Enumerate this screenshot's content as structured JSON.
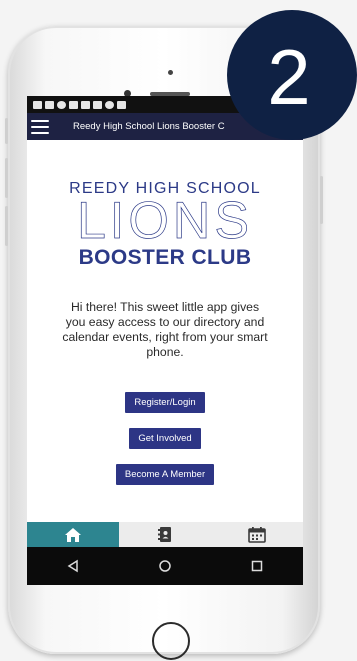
{
  "header": {
    "title": "Reedy High School Lions Booster C"
  },
  "brand": {
    "line1": "REEDY HIGH SCHOOL",
    "line2": "LIONS",
    "line3": "BOOSTER CLUB"
  },
  "intro_text": "Hi there! This sweet little app gives you easy access to our directory and calendar events, right from your smart phone.",
  "buttons": {
    "register": "Register/Login",
    "get_involved": "Get Involved",
    "become_member": "Become A Member"
  },
  "tabs": [
    {
      "icon": "home-icon",
      "active": true
    },
    {
      "icon": "directory-icon",
      "active": false
    },
    {
      "icon": "calendar-icon",
      "active": false
    }
  ],
  "step_badge": "2",
  "colors": {
    "brand_navy": "#2c3a87",
    "header_bg": "#1e2243",
    "button_bg": "#2d3585",
    "active_tab": "#2d8590",
    "badge_bg": "#0f2144"
  }
}
